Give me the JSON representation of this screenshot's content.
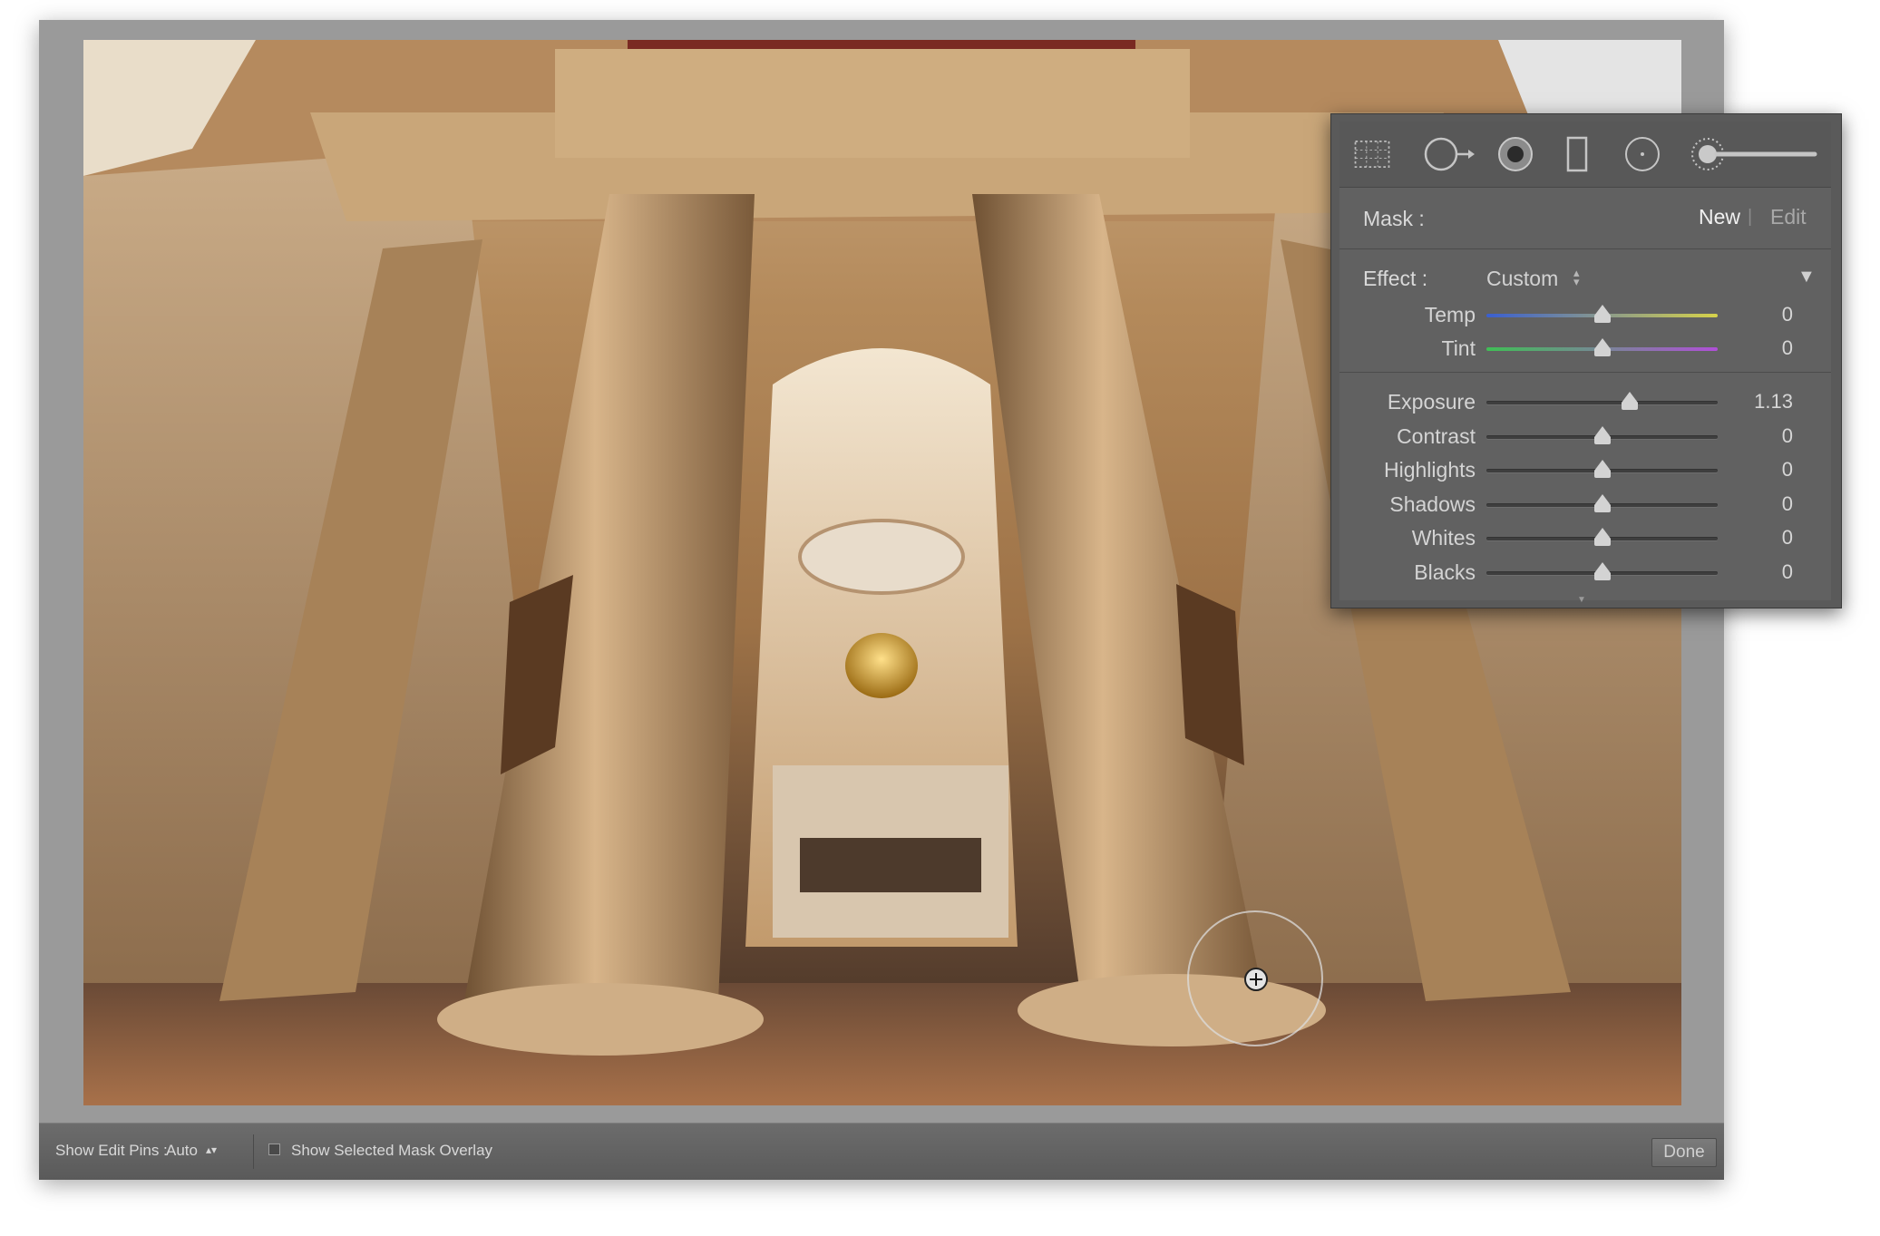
{
  "photo": {
    "description_alt": ""
  },
  "panel": {
    "mask_label": "Mask :",
    "mask_new": "New",
    "mask_edit": "Edit",
    "effect_label": "Effect :",
    "effect_value": "Custom",
    "sliders_color": [
      {
        "label": "Temp",
        "value": "0",
        "level": 0.5
      },
      {
        "label": "Tint",
        "value": "0",
        "level": 0.5
      }
    ],
    "sliders_tone": [
      {
        "label": "Exposure",
        "value": "1.13",
        "level": 0.62
      },
      {
        "label": "Contrast",
        "value": "0",
        "level": 0.5
      },
      {
        "label": "Highlights",
        "value": "0",
        "level": 0.5
      },
      {
        "label": "Shadows",
        "value": "0",
        "level": 0.5
      },
      {
        "label": "Whites",
        "value": "0",
        "level": 0.5
      },
      {
        "label": "Blacks",
        "value": "0",
        "level": 0.5
      }
    ],
    "tools": [
      "crop-overlay-icon",
      "spot-removal-icon",
      "red-eye-icon",
      "graduated-filter-icon",
      "radial-filter-icon",
      "adjustment-brush-icon"
    ]
  },
  "toolbar": {
    "show_edit_pins_label": "Show Edit Pins :",
    "show_edit_pins_value": "Auto",
    "overlay_label": "Show Selected Mask Overlay",
    "done_label": "Done"
  },
  "colors": {
    "temp_gradient": [
      "#3a5fd0",
      "#d6d24a"
    ],
    "tint_gradient": [
      "#3fbf55",
      "#b04fd8"
    ]
  }
}
